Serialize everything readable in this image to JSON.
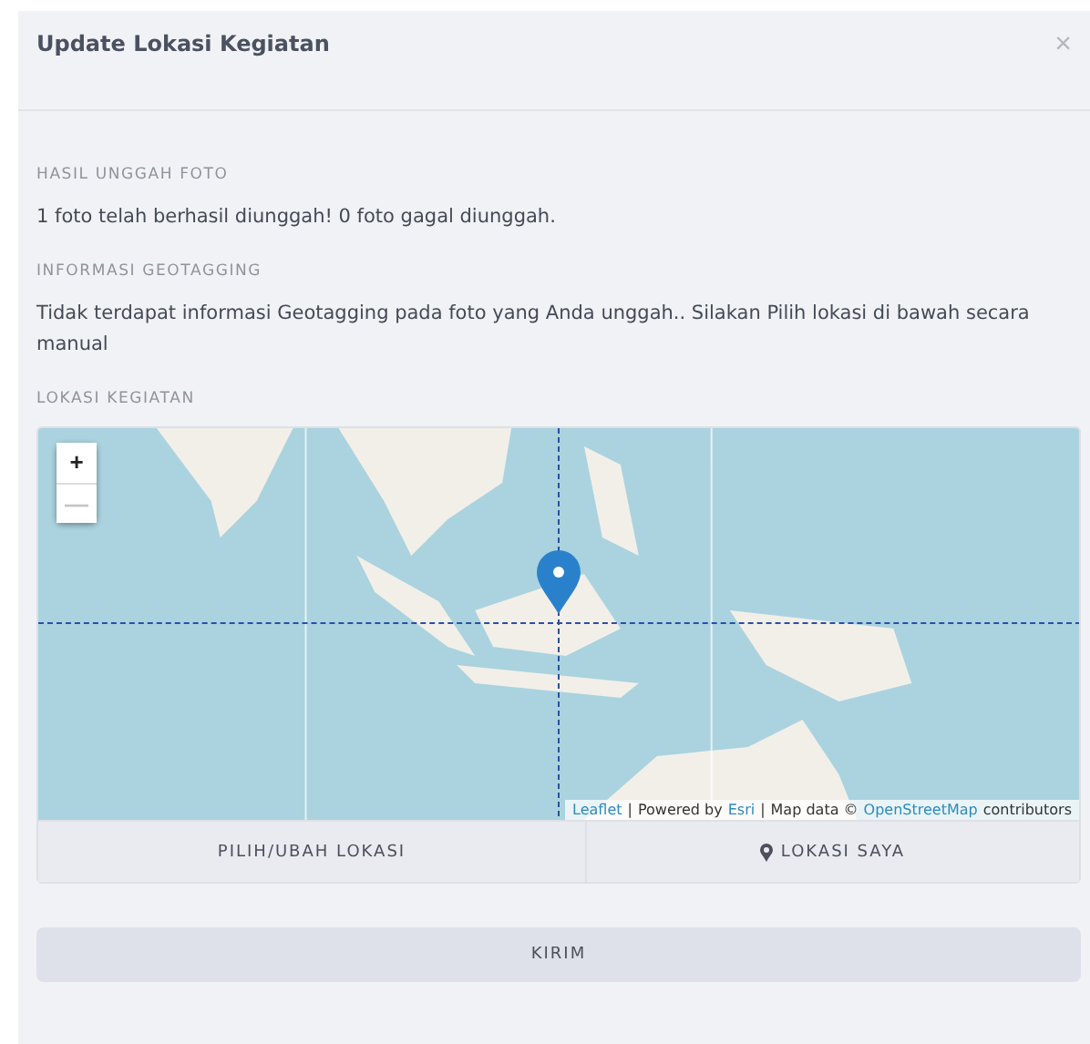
{
  "dialog": {
    "title": "Update Lokasi Kegiatan",
    "close": "×"
  },
  "sections": [
    {
      "label": "HASIL UNGGAH FOTO",
      "text": "1 foto telah berhasil diunggah! 0 foto gagal diunggah."
    },
    {
      "label": "INFORMASI GEOTAGGING",
      "text": "Tidak terdapat informasi Geotagging pada foto yang Anda unggah.. Silakan Pilih lokasi di bawah secara manual"
    }
  ],
  "map": {
    "label": "LOKASI KEGIATAN",
    "zoom_in": "+",
    "zoom_out": "—",
    "zoom_out_disabled": true,
    "attribution": [
      {
        "text": "Leaflet",
        "link": true
      },
      {
        "text": "|",
        "link": false
      },
      {
        "text": "Powered by",
        "link": false
      },
      {
        "text": "Esri",
        "link": true
      },
      {
        "text": "|",
        "link": false
      },
      {
        "text": "Map data ©",
        "link": false
      },
      {
        "text": "OpenStreetMap",
        "link": true
      },
      {
        "text": "contributors",
        "link": false
      }
    ]
  },
  "map_buttons": [
    {
      "label": "PILIH/UBAH LOKASI",
      "icon": false
    },
    {
      "label": "LOKASI SAYA",
      "icon": true
    }
  ],
  "submit": "KIRIM"
}
